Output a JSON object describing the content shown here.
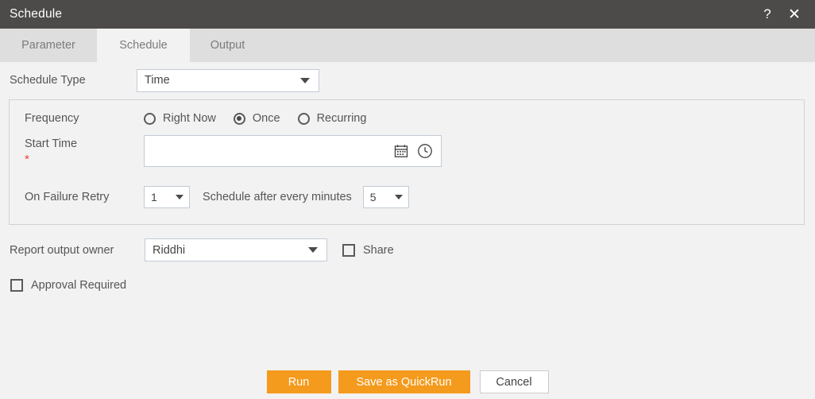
{
  "window": {
    "title": "Schedule",
    "help_icon": "?",
    "close_icon": "✕"
  },
  "tabs": [
    {
      "label": "Parameter",
      "active": false
    },
    {
      "label": "Schedule",
      "active": true
    },
    {
      "label": "Output",
      "active": false
    }
  ],
  "form": {
    "schedule_type": {
      "label": "Schedule Type",
      "value": "Time"
    },
    "frequency": {
      "label": "Frequency",
      "options": [
        {
          "label": "Right Now",
          "selected": false
        },
        {
          "label": "Once",
          "selected": true
        },
        {
          "label": "Recurring",
          "selected": false
        }
      ]
    },
    "start_time": {
      "label": "Start Time",
      "required_marker": "*",
      "value": "",
      "placeholder": "",
      "calendar_icon": "calendar-icon",
      "clock_icon": "clock-icon"
    },
    "on_failure_retry": {
      "label": "On Failure Retry",
      "retry_count": "1",
      "middle_label": "Schedule after every minutes",
      "minutes": "5"
    },
    "report_output_owner": {
      "label": "Report output owner",
      "value": "Riddhi"
    },
    "share": {
      "label": "Share",
      "checked": false
    },
    "approval_required": {
      "label": "Approval Required",
      "checked": false
    }
  },
  "footer": {
    "run_label": "Run",
    "save_quickrun_label": "Save as QuickRun",
    "cancel_label": "Cancel"
  },
  "colors": {
    "titlebar_bg": "#4d4b49",
    "tab_inactive_bg": "#dedede",
    "tab_active_bg": "#f2f2f2",
    "body_bg": "#f2f2f2",
    "accent_orange": "#f49a1c",
    "required_red": "#e8433a",
    "text": "#555555"
  }
}
